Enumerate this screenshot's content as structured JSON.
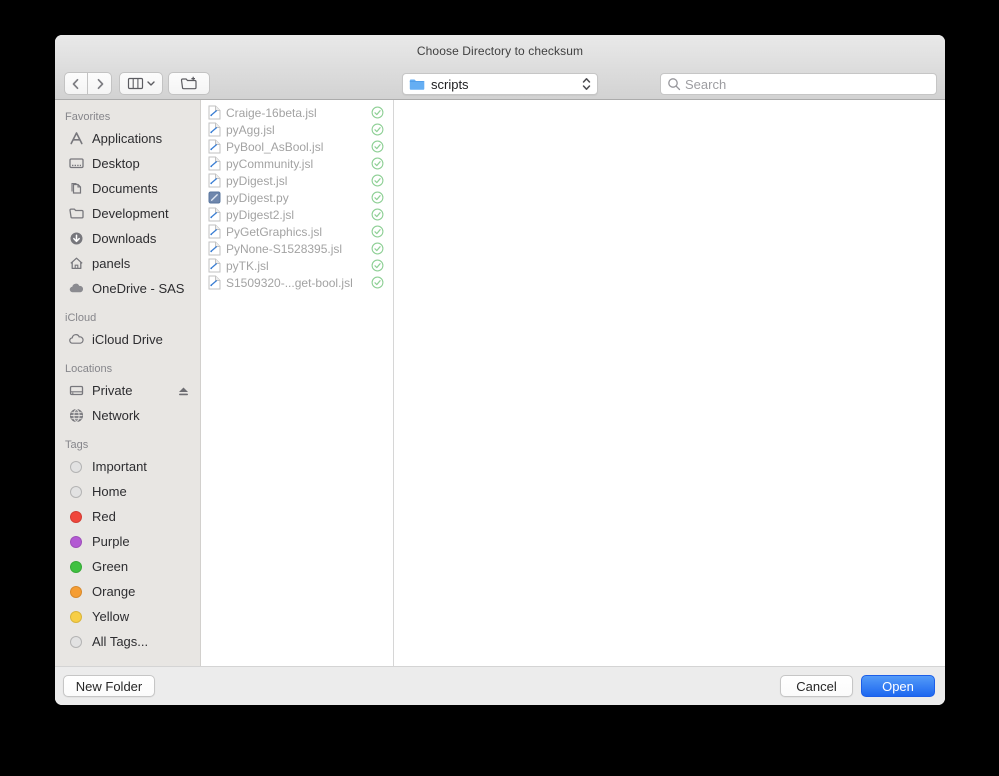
{
  "window": {
    "title": "Choose Directory to checksum"
  },
  "path_selector": {
    "value": "scripts"
  },
  "search": {
    "placeholder": "Search"
  },
  "sidebar": {
    "favorites": {
      "label": "Favorites",
      "items": [
        {
          "label": "Applications"
        },
        {
          "label": "Desktop"
        },
        {
          "label": "Documents"
        },
        {
          "label": "Development"
        },
        {
          "label": "Downloads"
        },
        {
          "label": "panels"
        },
        {
          "label": "OneDrive - SAS"
        }
      ]
    },
    "icloud": {
      "label": "iCloud",
      "items": [
        {
          "label": "iCloud Drive"
        }
      ]
    },
    "locations": {
      "label": "Locations",
      "items": [
        {
          "label": "Private"
        },
        {
          "label": "Network"
        }
      ]
    },
    "tags": {
      "label": "Tags",
      "items": [
        {
          "label": "Important",
          "color": "#e2e2e2",
          "filled": false
        },
        {
          "label": "Home",
          "color": "#e2e2e2",
          "filled": false
        },
        {
          "label": "Red",
          "color": "#f0473c",
          "filled": true
        },
        {
          "label": "Purple",
          "color": "#b35ad3",
          "filled": true
        },
        {
          "label": "Green",
          "color": "#3fc140",
          "filled": true
        },
        {
          "label": "Orange",
          "color": "#f59d33",
          "filled": true
        },
        {
          "label": "Yellow",
          "color": "#f7ce45",
          "filled": true
        },
        {
          "label": "All Tags...",
          "color": "#cfcfcf",
          "filled": false
        }
      ]
    }
  },
  "file_list": {
    "items": [
      {
        "name": "Craige-16beta.jsl",
        "type": "jsl",
        "status": "synced"
      },
      {
        "name": "pyAgg.jsl",
        "type": "jsl",
        "status": "synced"
      },
      {
        "name": "PyBool_AsBool.jsl",
        "type": "jsl",
        "status": "synced"
      },
      {
        "name": "pyCommunity.jsl",
        "type": "jsl",
        "status": "synced"
      },
      {
        "name": "pyDigest.jsl",
        "type": "jsl",
        "status": "synced"
      },
      {
        "name": "pyDigest.py",
        "type": "py",
        "status": "synced"
      },
      {
        "name": "pyDigest2.jsl",
        "type": "jsl",
        "status": "synced"
      },
      {
        "name": "PyGetGraphics.jsl",
        "type": "jsl",
        "status": "synced"
      },
      {
        "name": "PyNone-S1528395.jsl",
        "type": "jsl",
        "status": "synced"
      },
      {
        "name": "pyTK.jsl",
        "type": "jsl",
        "status": "synced"
      },
      {
        "name": "S1509320-...get-bool.jsl",
        "type": "jsl",
        "status": "synced"
      }
    ]
  },
  "footer": {
    "new_folder_label": "New Folder",
    "cancel_label": "Cancel",
    "open_label": "Open"
  },
  "colors": {
    "accent_blue": "#2e7ef0",
    "check_green": "#8fd096",
    "folder_blue": "#65aef3"
  }
}
